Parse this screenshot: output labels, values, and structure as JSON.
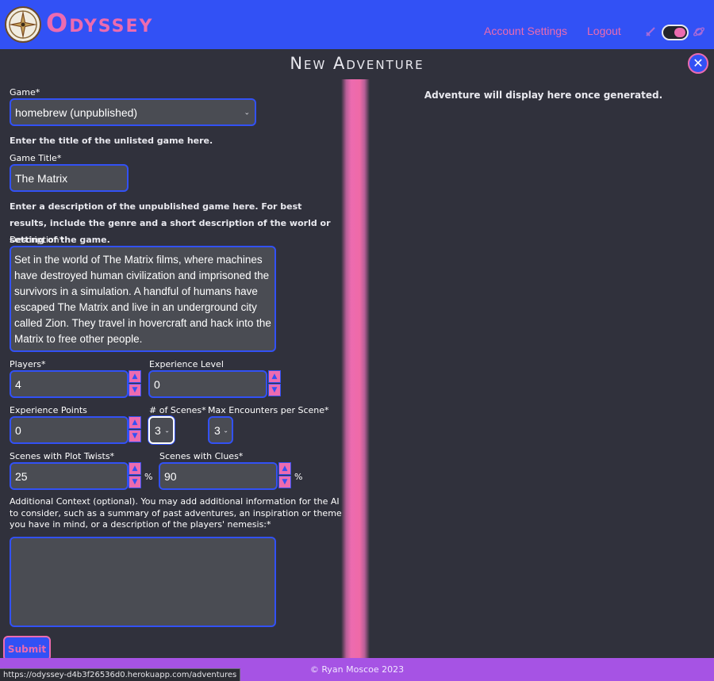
{
  "header": {
    "brand": "Odyssey",
    "nav": {
      "account_settings": "Account Settings",
      "logout": "Logout"
    },
    "icons": [
      "compass-logo-icon",
      "sword-icon",
      "theme-toggle",
      "planet-icon"
    ]
  },
  "page_title": "New Adventure",
  "close_label": "✕",
  "result_placeholder": "Adventure will display here once generated.",
  "form": {
    "game": {
      "label": "Game*",
      "value": "homebrew (unpublished)"
    },
    "title_helper": "Enter the title of the unlisted game here.",
    "game_title": {
      "label": "Game Title*",
      "value": "The Matrix"
    },
    "description_helper": "Enter a description of the unpublished game here. For best results, include the genre and a short description of the world or setting of the game.",
    "description": {
      "label": "Description*",
      "value": "Set in the world of The Matrix films, where machines have destroyed human civilization and imprisoned the survivors in a simulation. A handful of humans have escaped The Matrix and live in an underground city called Zion. They travel in hovercraft and hack into the Matrix to free other people."
    },
    "players": {
      "label": "Players*",
      "value": "4"
    },
    "experience_level": {
      "label": "Experience Level",
      "value": "0"
    },
    "experience_points": {
      "label": "Experience Points",
      "value": "0"
    },
    "num_scenes": {
      "label": "# of Scenes*",
      "value": "3"
    },
    "max_encounters": {
      "label": "Max Encounters per Scene*",
      "value": "3"
    },
    "plot_twists": {
      "label": "Scenes with Plot Twists*",
      "value": "25",
      "unit": "%"
    },
    "clues": {
      "label": "Scenes with Clues*",
      "value": "90",
      "unit": "%"
    },
    "additional_context": {
      "label": "Additional Context (optional). You may add additional information for the AI to consider, such as a summary of past adventures, an inspiration or theme you have in mind, or a description of the players' nemesis:*",
      "value": ""
    },
    "submit_label": "Submit"
  },
  "footer": {
    "copyright": "© Ryan Moscoe 2023"
  },
  "status_url": "https://odyssey-d4b3f26536d0.herokuapp.com/adventures",
  "colors": {
    "primary": "#3251f5",
    "accent": "#ec6bb0",
    "background": "#30313c",
    "footer": "#a653e4"
  }
}
